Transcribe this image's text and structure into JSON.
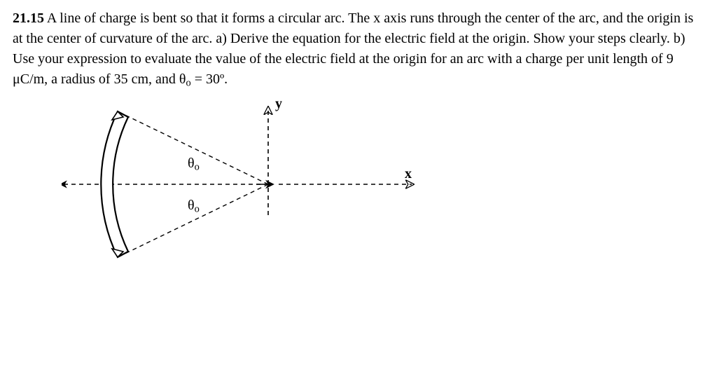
{
  "problem": {
    "number": "21.15",
    "text_before_subscript": "A line of charge is bent so that it forms a circular arc. The x axis runs through the center of the arc, and the origin is at the center of curvature of the arc. a) Derive the equation for the electric field at the origin. Show your steps clearly. b) Use your expression to evaluate the value of the electric field at the origin for an arc with a charge per unit length of 9 μC/m, a radius of 35 cm, and θ",
    "subscript": "o",
    "text_after_subscript": " = 30º."
  },
  "figure": {
    "axis_y": "y",
    "axis_x": "x",
    "theta_top_sym": "θ",
    "theta_top_sub": "o",
    "theta_bot_sym": "θ",
    "theta_bot_sub": "o"
  }
}
